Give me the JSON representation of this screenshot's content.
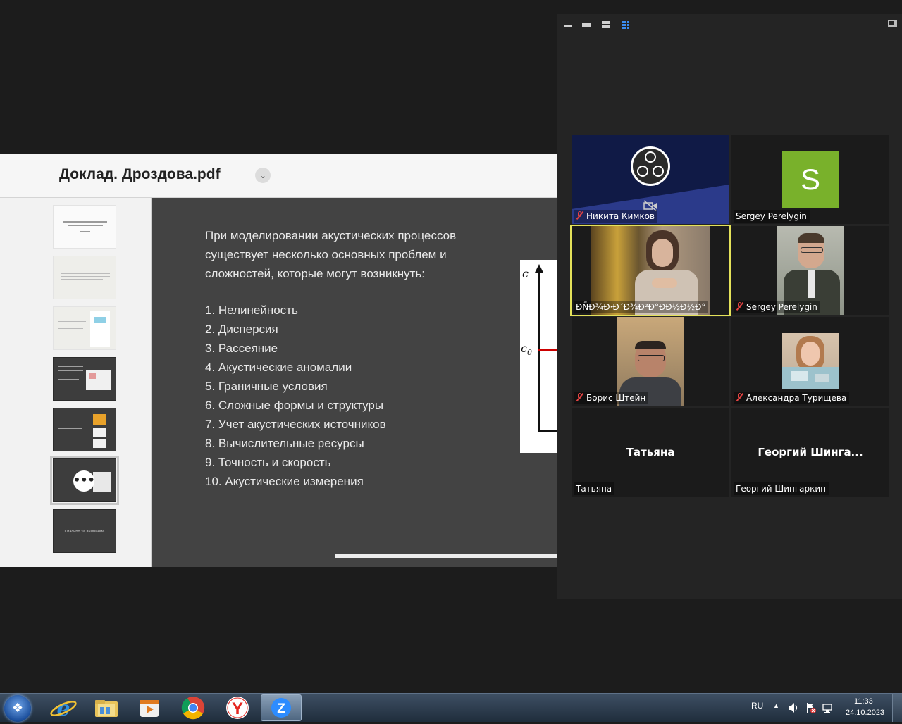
{
  "shared_screen": {
    "document_title": "Доклад. Дроздова.pdf",
    "thumbnails": [
      {
        "style": "light",
        "text": ""
      },
      {
        "style": "beige",
        "text": ""
      },
      {
        "style": "beige",
        "text": ""
      },
      {
        "style": "dark",
        "text": ""
      },
      {
        "style": "dark",
        "text": ""
      },
      {
        "style": "dark",
        "text": ""
      },
      {
        "style": "dark",
        "text": "Спасибо за внимание"
      }
    ],
    "slide": {
      "intro": "При моделировании акустических процессов существует несколько основных проблем и сложностей, которые могут возникнуть:",
      "items": [
        "1. Нелинейность",
        "2. Дисперсия",
        "3. Рассеяние",
        "4. Акустические аномалии",
        "5. Граничные условия",
        "6. Сложные формы и структуры",
        "7. Учет акустических источников",
        "8. Вычислительные ресурсы",
        "9. Точность и скорость",
        "10. Акустические измерения"
      ],
      "figure": {
        "axis_label": "c",
        "level_label": "c",
        "level_subscript": "0",
        "line_color": "#cc0000"
      }
    }
  },
  "gallery": {
    "view_modes": [
      "minimize-view",
      "speaker-view",
      "strip-view",
      "gallery-view"
    ],
    "participants": [
      {
        "name": "Никита Кимков",
        "muted": true,
        "avatar": "obs-logo-icon",
        "video_off": true
      },
      {
        "name": "Sergey Perelygin",
        "muted": false,
        "avatar_letter": "S",
        "avatar_color": "#79b12b"
      },
      {
        "name": "ÐÑÐ¾Ð·Ð´Ð¾Ð²Ð°ÐÐ½Ð½Ð°",
        "muted": false,
        "active_speaker": true,
        "highlight_color": "#e4e25a"
      },
      {
        "name": "Sergey Perelygin",
        "muted": true
      },
      {
        "name": "Борис Штейн",
        "muted": true
      },
      {
        "name": "Александра Турищева",
        "muted": true
      },
      {
        "name": "Татьяна",
        "muted": false,
        "center_name": "Татьяна"
      },
      {
        "name": "Георгий Шингаркин",
        "muted": false,
        "center_name": "Георгий  Шинга..."
      }
    ]
  },
  "taskbar": {
    "apps": [
      "start-button",
      "internet-explorer-icon",
      "file-explorer-icon",
      "media-player-icon",
      "chrome-icon",
      "yandex-browser-icon",
      "zoom-icon"
    ],
    "language": "RU",
    "time": "11:33",
    "date": "24.10.2023"
  }
}
